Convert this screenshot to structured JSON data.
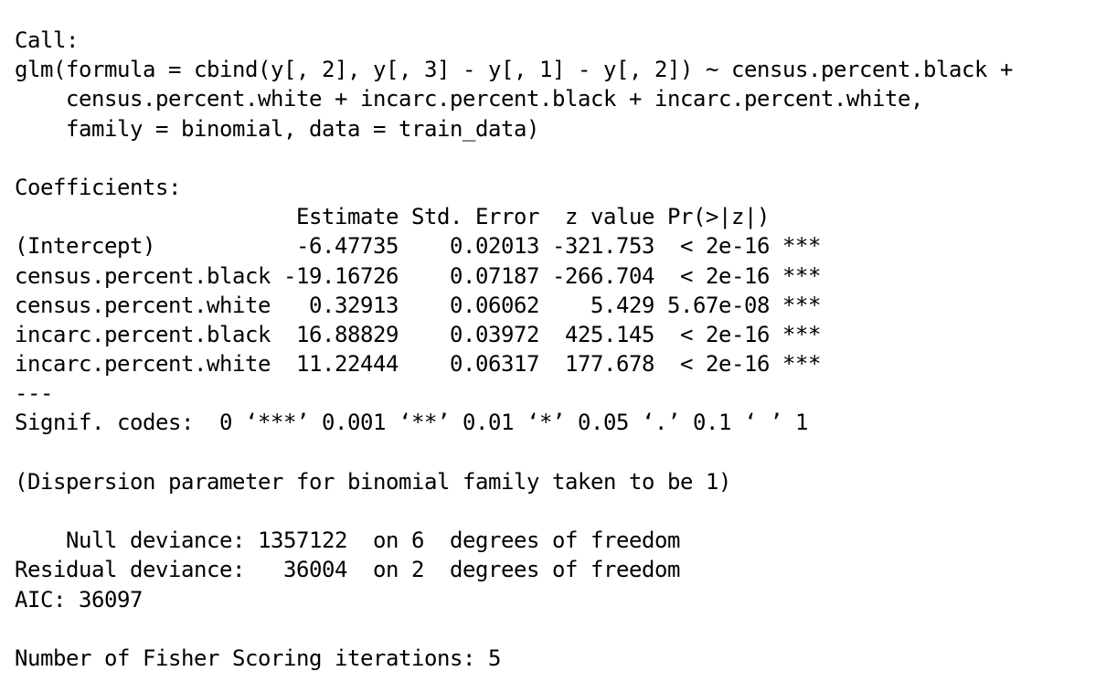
{
  "output": {
    "lines": [
      "Call:",
      "glm(formula = cbind(y[, 2], y[, 3] - y[, 1] - y[, 2]) ~ census.percent.black +",
      "    census.percent.white + incarc.percent.black + incarc.percent.white,",
      "    family = binomial, data = train_data)",
      "",
      "Coefficients:",
      "                      Estimate Std. Error  z value Pr(>|z|)    ",
      "(Intercept)           -6.47735    0.02013 -321.753  < 2e-16 ***",
      "census.percent.black -19.16726    0.07187 -266.704  < 2e-16 ***",
      "census.percent.white   0.32913    0.06062    5.429 5.67e-08 ***",
      "incarc.percent.black  16.88829    0.03972  425.145  < 2e-16 ***",
      "incarc.percent.white  11.22444    0.06317  177.678  < 2e-16 ***",
      "---",
      "Signif. codes:  0 ‘***’ 0.001 ‘**’ 0.01 ‘*’ 0.05 ‘.’ 0.1 ‘ ’ 1",
      "",
      "(Dispersion parameter for binomial family taken to be 1)",
      "",
      "    Null deviance: 1357122  on 6  degrees of freedom",
      "Residual deviance:   36004  on 2  degrees of freedom",
      "AIC: 36097",
      "",
      "Number of Fisher Scoring iterations: 5"
    ]
  }
}
